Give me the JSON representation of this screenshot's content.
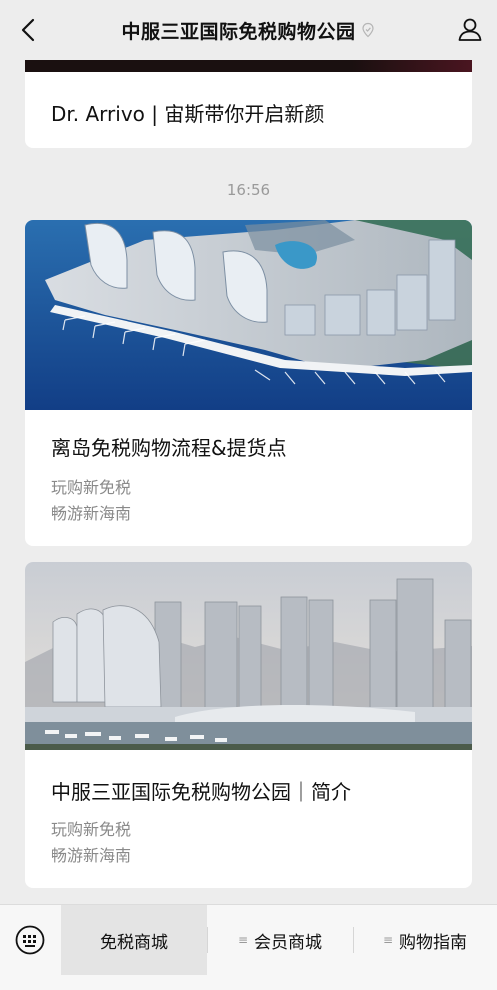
{
  "header": {
    "title": "中服三亚国际免税购物公园",
    "back_icon": "chevron-left-icon",
    "verify_icon": "verified-badge-icon",
    "profile_icon": "user-icon"
  },
  "articles": [
    {
      "title": "Dr. Arrivo | 宙斯带你开启新颜"
    }
  ],
  "timestamp": "16:56",
  "cards": [
    {
      "headline": "离岛免税购物流程&提货点",
      "sub1": "玩购新免税",
      "sub2": "畅游新海南"
    },
    {
      "headline": "中服三亚国际免税购物公园｜简介",
      "sub1": "玩购新免税",
      "sub2": "畅游新海南"
    }
  ],
  "menu": {
    "keyboard_icon": "keyboard-icon",
    "items": [
      {
        "label": "免税商城"
      },
      {
        "label": "会员商城"
      },
      {
        "label": "购物指南"
      }
    ],
    "menu_icon": "hamburger-icon"
  },
  "colors": {
    "background": "#ededed",
    "card": "#ffffff",
    "muted_text": "#8a8a8a"
  }
}
